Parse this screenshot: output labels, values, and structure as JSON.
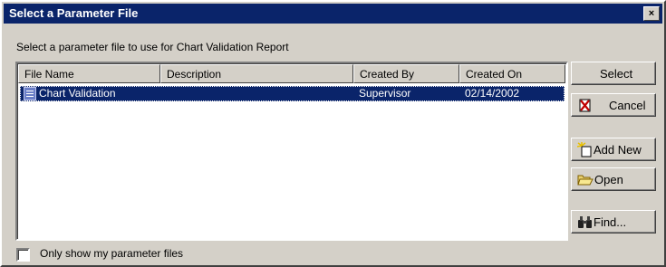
{
  "window": {
    "title": "Select a Parameter File",
    "close_glyph": "×"
  },
  "instruction": "Select a parameter file to use for Chart Validation Report",
  "table": {
    "columns": [
      "File Name",
      "Description",
      "Created By",
      "Created On"
    ],
    "rows": [
      {
        "file_name": "Chart Validation",
        "description": "",
        "created_by": "Supervisor",
        "created_on": "02/14/2002",
        "selected": true
      }
    ]
  },
  "buttons": {
    "select": "Select",
    "cancel": "Cancel",
    "add_new": "Add New",
    "open": "Open",
    "find": "Find..."
  },
  "checkbox": {
    "label": "Only show my parameter files",
    "checked": false
  },
  "colors": {
    "title_bar": "#0a246a",
    "selection": "#0a246a",
    "face": "#d4d0c8"
  }
}
